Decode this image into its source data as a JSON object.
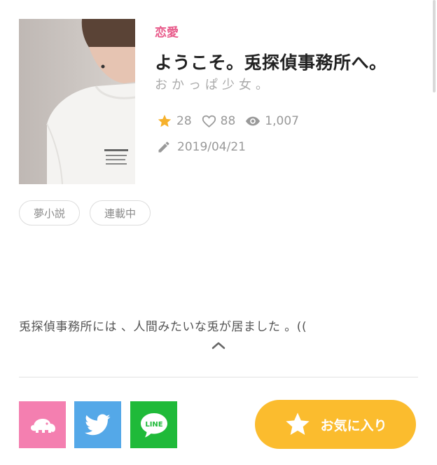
{
  "work": {
    "genre": "恋愛",
    "title": "ようこそ。兎探偵事務所へ。",
    "author": "おかっぱ少女。",
    "stats": {
      "stars": "28",
      "likes": "88",
      "views": "1,007"
    },
    "updated": "2019/04/21",
    "tags": [
      "夢小説",
      "連載中"
    ],
    "description": "兎探偵事務所には 、人間みたいな兎が居ました 。(("
  },
  "share": {
    "line_label": "LINE"
  },
  "actions": {
    "favorite_label": "お気に入り"
  },
  "colors": {
    "genre": "#e85a8a",
    "star": "#f6b12c",
    "ebook_share": "#f47fb0",
    "twitter_share": "#54a8e8",
    "line_share": "#1fba39",
    "favorite": "#fbbc2e"
  },
  "icons": [
    "star-icon",
    "heart-icon",
    "eye-icon",
    "pencil-icon",
    "chevron-up-icon",
    "elephant-icon",
    "twitter-bird-icon",
    "line-icon"
  ]
}
